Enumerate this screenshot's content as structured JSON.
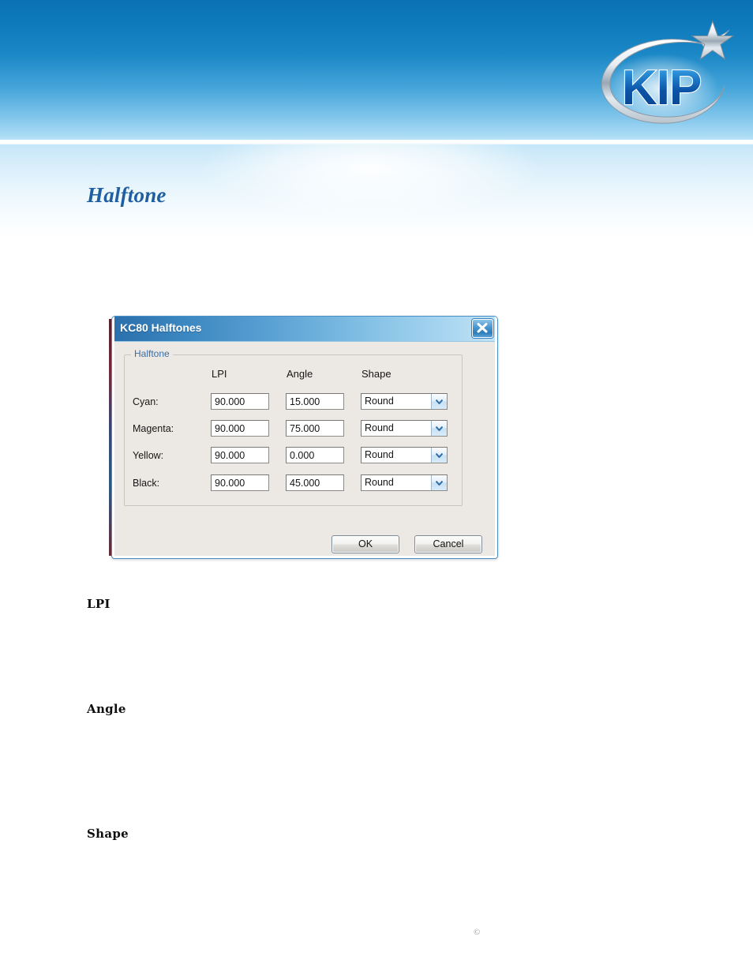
{
  "header": {
    "logo_text": "KIP",
    "logo_icon": "kip-star-swoosh-logo"
  },
  "page": {
    "title": "Halftone",
    "copyright_mark": "©"
  },
  "sections": [
    {
      "heading": "LPI"
    },
    {
      "heading": "Angle"
    },
    {
      "heading": "Shape"
    }
  ],
  "dialog": {
    "title": "KC80 Halftones",
    "close_icon": "close-icon",
    "groupbox_legend": "Halftone",
    "columns": {
      "lpi": "LPI",
      "angle": "Angle",
      "shape": "Shape"
    },
    "rows": [
      {
        "label": "Cyan:",
        "lpi": "90.000",
        "angle": "15.000",
        "shape": "Round"
      },
      {
        "label": "Magenta:",
        "lpi": "90.000",
        "angle": "75.000",
        "shape": "Round"
      },
      {
        "label": "Yellow:",
        "lpi": "90.000",
        "angle": "0.000",
        "shape": "Round"
      },
      {
        "label": "Black:",
        "lpi": "90.000",
        "angle": "45.000",
        "shape": "Round"
      }
    ],
    "shape_options": [
      "Round"
    ],
    "buttons": {
      "ok": "OK",
      "cancel": "Cancel"
    }
  },
  "colors": {
    "header_top": "#0b72b5",
    "header_bottom": "#bde4f8",
    "title_blue": "#1f5fa0",
    "dialog_face": "#ece9e4",
    "dialog_border": "#4a90c8",
    "legend_blue": "#3a6ea5"
  }
}
